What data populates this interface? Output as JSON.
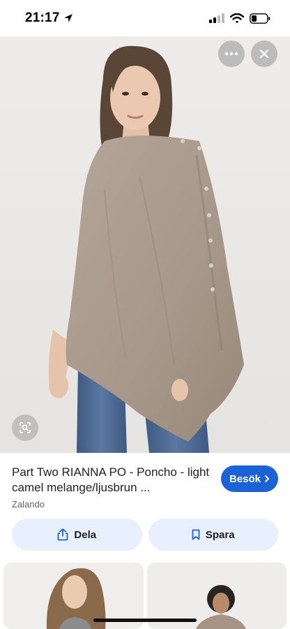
{
  "status_bar": {
    "time": "21:17",
    "icons": [
      "location-arrow-icon",
      "signal-icon",
      "wifi-icon",
      "battery-icon"
    ]
  },
  "image_viewer": {
    "overlay_buttons": [
      "more-options-icon",
      "close-icon",
      "lens-search-icon"
    ]
  },
  "product": {
    "title": "Part Two RIANNA PO - Poncho - light camel melange/ljusbrun ...",
    "source": "Zalando",
    "visit_label": "Besök"
  },
  "actions": {
    "share_label": "Dela",
    "save_label": "Spara"
  },
  "colors": {
    "accent": "#1a62d6",
    "action_bg": "#e8f0fe",
    "poncho": "#a8998a",
    "jeans": "#4e6a93"
  }
}
